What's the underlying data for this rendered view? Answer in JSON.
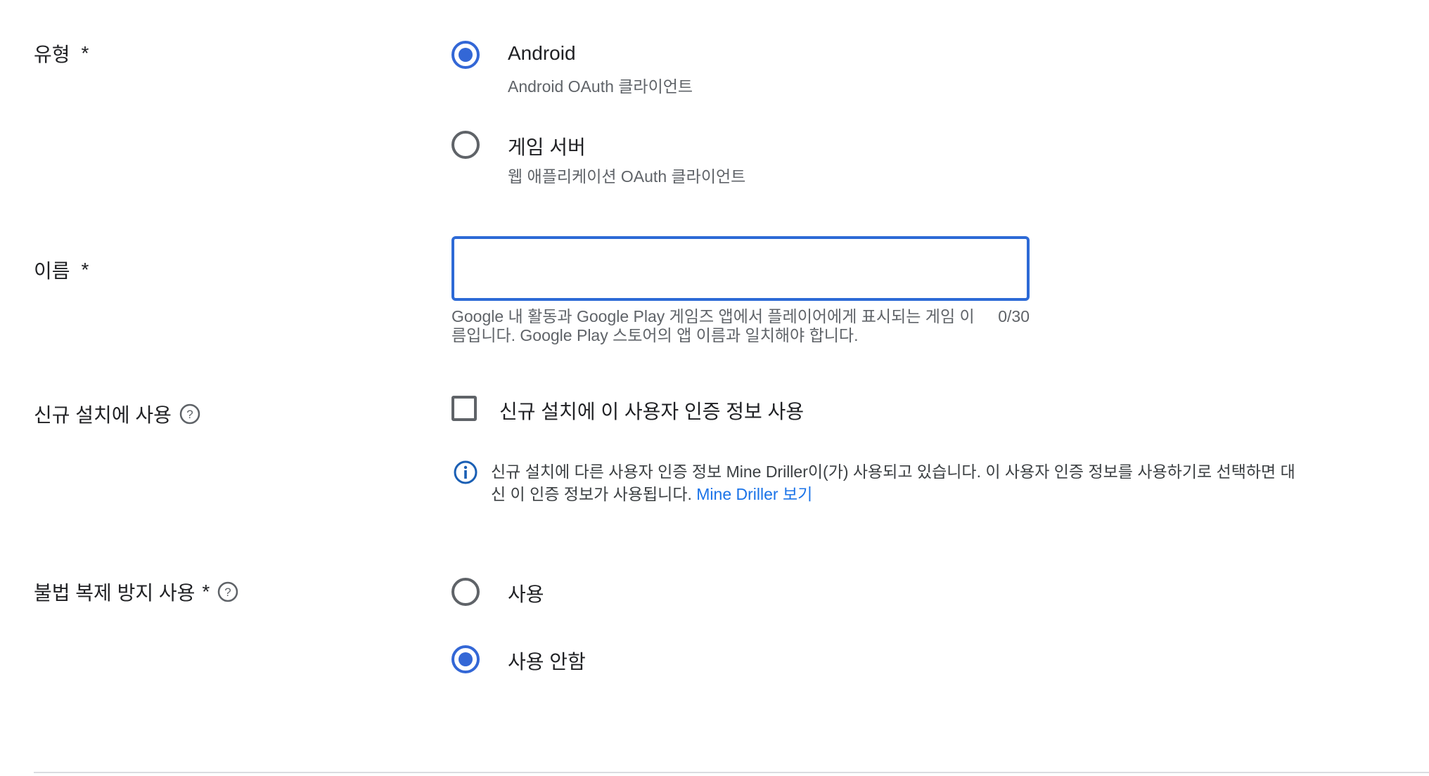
{
  "type_section": {
    "label": "유형",
    "required_mark": "*",
    "options": [
      {
        "title": "Android",
        "description": "Android OAuth 클라이언트",
        "selected": true
      },
      {
        "title": "게임 서버",
        "description": "웹 애플리케이션 OAuth 클라이언트",
        "selected": false
      }
    ]
  },
  "name_section": {
    "label": "이름",
    "required_mark": "*",
    "input_value": "",
    "hint": "Google 내 활동과 Google Play 게임즈 앱에서 플레이어에게 표시되는 게임 이름입니다. Google Play 스토어의 앱 이름과 일치해야 합니다.",
    "counter": "0/30"
  },
  "new_install_section": {
    "label": "신규 설치에 사용",
    "help_icon": "help-circle-icon",
    "checkbox_label": "신규 설치에 이 사용자 인증 정보 사용",
    "checked": false,
    "info_icon": "info-icon",
    "info_text": "신규 설치에 다른 사용자 인증 정보 Mine Driller이(가) 사용되고 있습니다. 이 사용자 인증 정보를 사용하기로 선택하면 대신 이 인증 정보가 사용됩니다.",
    "info_link": "Mine Driller 보기"
  },
  "anti_piracy_section": {
    "label": "불법 복제 방지 사용",
    "required_mark": "*",
    "help_icon": "help-circle-icon",
    "options": [
      {
        "title": "사용",
        "selected": false
      },
      {
        "title": "사용 안함",
        "selected": true
      }
    ]
  },
  "colors": {
    "accent": "#3367d6",
    "link": "#1a73e8",
    "secondary_text": "#5f6368"
  }
}
